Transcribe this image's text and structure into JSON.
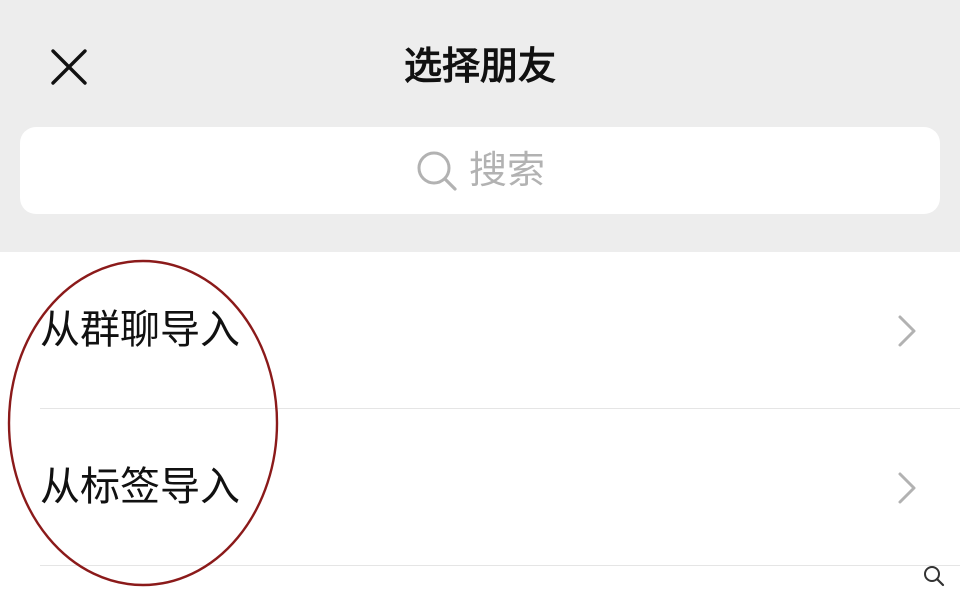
{
  "header": {
    "title": "选择朋友",
    "close_icon": "close-icon"
  },
  "search": {
    "placeholder": "搜索",
    "icon": "search-icon"
  },
  "list": {
    "items": [
      {
        "label": "从群聊导入",
        "icon": "chevron-right-icon"
      },
      {
        "label": "从标签导入",
        "icon": "chevron-right-icon"
      }
    ]
  },
  "colors": {
    "header_background": "#ededed",
    "title_text": "#111111",
    "placeholder_text": "#b2b2b2",
    "chevron": "#b2b2b2",
    "annotation_circle": "#8b1a1a"
  }
}
